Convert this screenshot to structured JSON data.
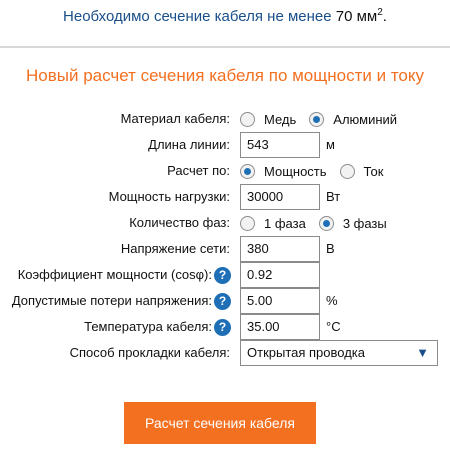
{
  "result": {
    "lead": "Необходимо сечение кабеля не менее",
    "value": "70",
    "unit": "мм",
    "unit_power": "2",
    "end": "."
  },
  "title": "Новый расчет сечения кабеля по мощности и току",
  "form": {
    "material": {
      "label": "Материал кабеля:",
      "options": [
        "Медь",
        "Алюминий"
      ],
      "selected": "Алюминий"
    },
    "length": {
      "label": "Длина линии:",
      "value": "543",
      "unit": "м"
    },
    "calc_by": {
      "label": "Расчет по:",
      "options": [
        "Мощность",
        "Ток"
      ],
      "selected": "Мощность"
    },
    "power": {
      "label": "Мощность нагрузки:",
      "value": "30000",
      "unit": "Вт"
    },
    "phases": {
      "label": "Количество фаз:",
      "options": [
        "1 фаза",
        "3 фазы"
      ],
      "selected": "3 фазы"
    },
    "voltage": {
      "label": "Напряжение сети:",
      "value": "380",
      "unit": "В"
    },
    "power_factor": {
      "label": "Коэффициент мощности (cosφ):",
      "value": "0.92",
      "help": "?"
    },
    "voltage_loss": {
      "label": "Допустимые потери напряжения:",
      "value": "5.00",
      "unit": "%",
      "help": "?"
    },
    "temperature": {
      "label": "Температура кабеля:",
      "value": "35.00",
      "unit": "°C",
      "help": "?"
    },
    "laying": {
      "label": "Способ прокладки кабеля:",
      "selected": "Открытая проводка",
      "caret": "▼"
    }
  },
  "submit_label": "Расчет сечения кабеля",
  "colors": {
    "accent": "#f37021",
    "link": "#1a4f8a",
    "radio": "#1e6fb5"
  }
}
